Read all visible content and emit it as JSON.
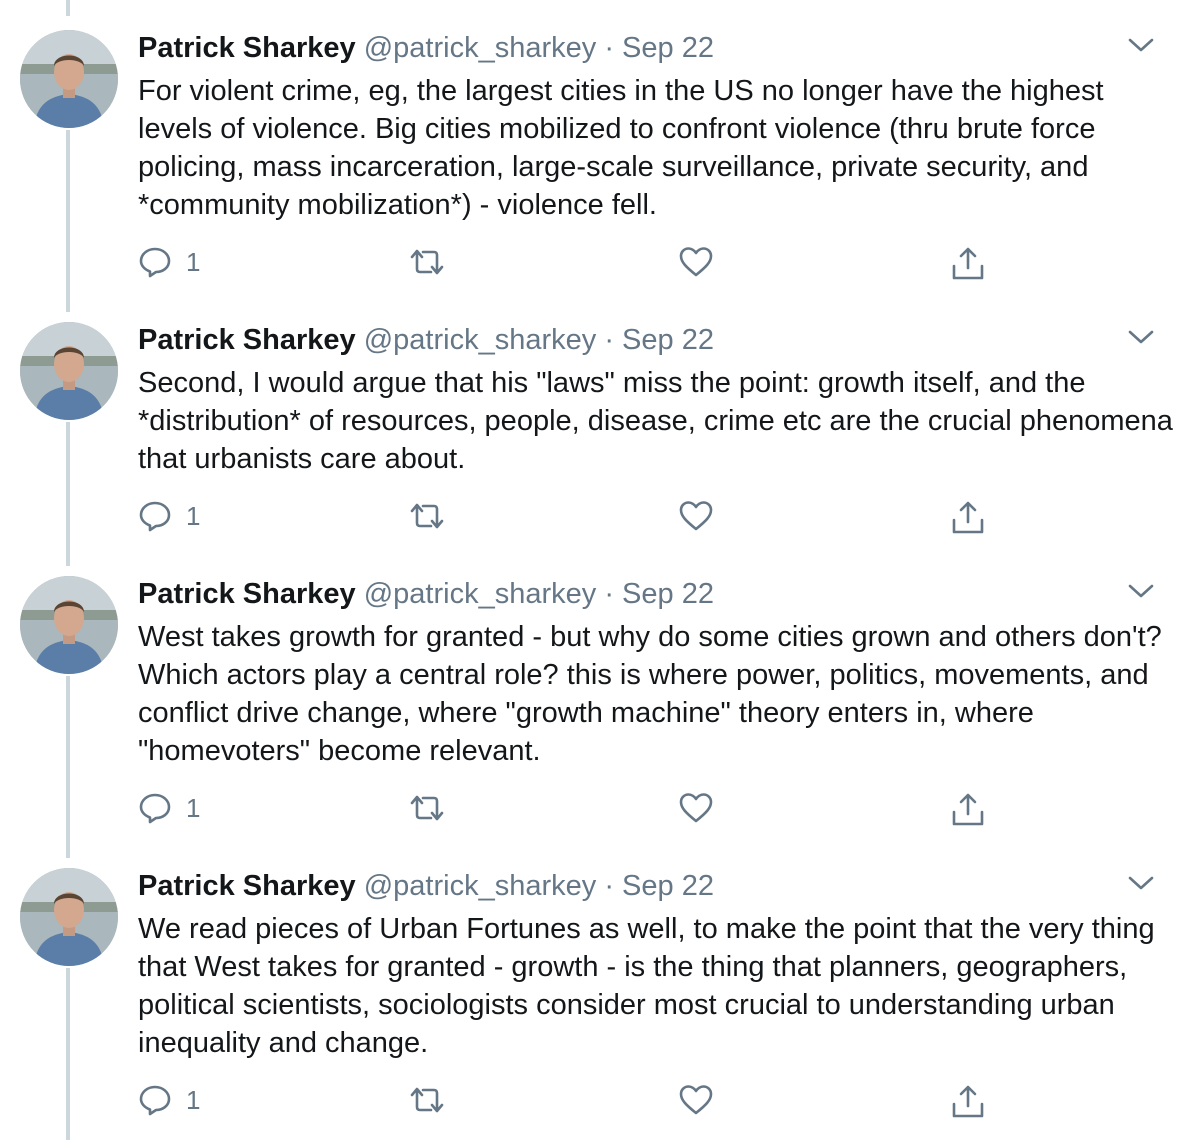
{
  "tweets": [
    {
      "name": "Patrick Sharkey",
      "handle": "@patrick_sharkey",
      "separator": "·",
      "date": "Sep 22",
      "text": "For violent crime, eg, the largest cities in the US no longer have the highest levels of violence. Big cities mobilized to confront violence (thru brute force policing, mass incarceration, large-scale surveillance, private security,  and *community mobilization*) - violence fell.",
      "reply_count": "1"
    },
    {
      "name": "Patrick Sharkey",
      "handle": "@patrick_sharkey",
      "separator": "·",
      "date": "Sep 22",
      "text": "Second, I would argue that his \"laws\" miss the point: growth itself, and the *distribution* of resources, people, disease, crime etc are the crucial phenomena that urbanists care about.",
      "reply_count": "1"
    },
    {
      "name": "Patrick Sharkey",
      "handle": "@patrick_sharkey",
      "separator": "·",
      "date": "Sep 22",
      "text": "West takes growth for granted - but why do some cities grown and others don't? Which actors play a central role? this is where power, politics, movements, and conflict drive change, where \"growth machine\" theory enters in, where \"homevoters\" become relevant.",
      "reply_count": "1"
    },
    {
      "name": "Patrick Sharkey",
      "handle": "@patrick_sharkey",
      "separator": "·",
      "date": "Sep 22",
      "text": "We read pieces of Urban Fortunes as well, to make the point that the very thing that West takes for granted - growth - is the thing that planners, geographers, political scientists, sociologists consider most crucial to understanding urban inequality and change.",
      "reply_count": "1"
    }
  ],
  "icons": {
    "reply": "reply-icon",
    "retweet": "retweet-icon",
    "like": "like-icon",
    "share": "share-icon",
    "more": "chevron-down-icon"
  },
  "colors": {
    "text": "#14171a",
    "secondary": "#657786",
    "thread_line": "#ccd6dd"
  }
}
